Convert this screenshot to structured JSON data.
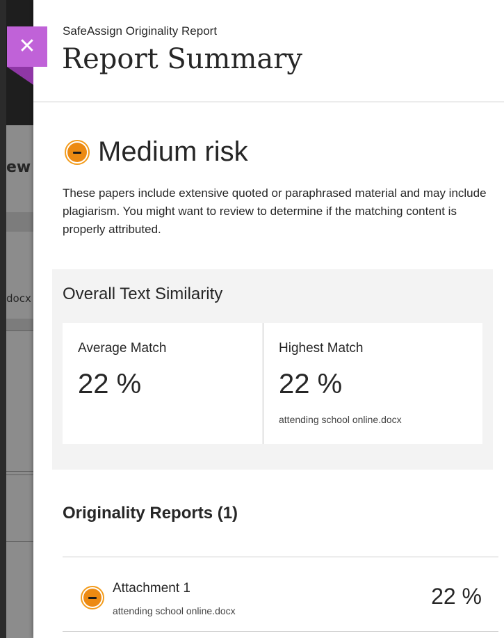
{
  "background_page": {
    "heading_fragment": "ew",
    "filename_fragment": "docx"
  },
  "panel": {
    "close_icon": "close-icon",
    "eyebrow": "SafeAssign Originality Report",
    "title": "Report Summary"
  },
  "risk": {
    "icon": "medium-risk-icon",
    "label": "Medium risk",
    "description": "These papers include extensive quoted or paraphrased material and may include plagiarism. You might want to review to determine if the matching content is properly attributed.",
    "color": "#ec8a12"
  },
  "similarity": {
    "title": "Overall Text Similarity",
    "average": {
      "label": "Average Match",
      "value": "22 %"
    },
    "highest": {
      "label": "Highest Match",
      "value": "22 %",
      "file": "attending school online.docx"
    }
  },
  "reports": {
    "heading": "Originality Reports (1)",
    "items": [
      {
        "name": "Attachment 1",
        "file": "attending school online.docx",
        "percent": "22 %",
        "icon": "medium-risk-icon"
      }
    ]
  },
  "colors": {
    "accent_purple": "#c062d8",
    "risk_orange": "#ec8a12",
    "card_bg": "#f3f3f3"
  }
}
